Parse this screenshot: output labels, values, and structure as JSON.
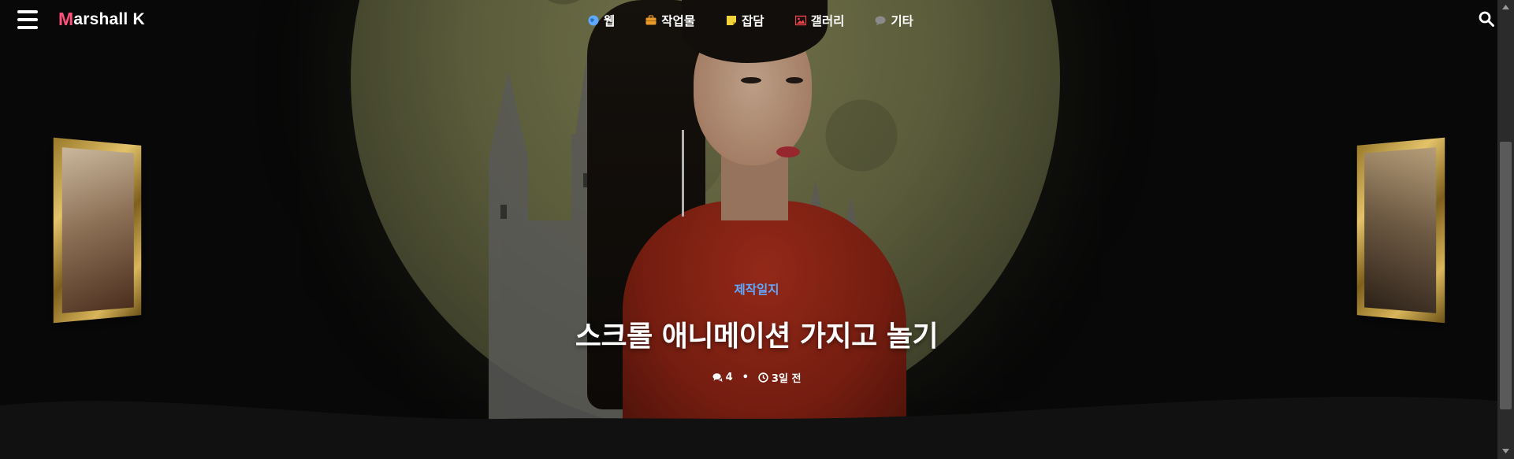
{
  "site": {
    "logo_letter": "M",
    "logo_rest": "arshall K"
  },
  "nav": [
    {
      "label": "웹",
      "icon": "globe-icon",
      "color": "#5ea8ff"
    },
    {
      "label": "작업물",
      "icon": "briefcase-icon",
      "color": "#e79a2a"
    },
    {
      "label": "잡담",
      "icon": "sticky-note-icon",
      "color": "#f2d23a"
    },
    {
      "label": "갤러리",
      "icon": "image-icon",
      "color": "#f0424a"
    },
    {
      "label": "기타",
      "icon": "comment-icon",
      "color": "#8a8a8a"
    }
  ],
  "post": {
    "category": "제작일지",
    "title": "스크롤 애니메이션 가지고 놀기",
    "comments": "4",
    "time": "3일 전"
  },
  "colors": {
    "accent": "#5ea8ff",
    "logo_accent": "#ff4f7b",
    "background": "#0b0b0b"
  }
}
